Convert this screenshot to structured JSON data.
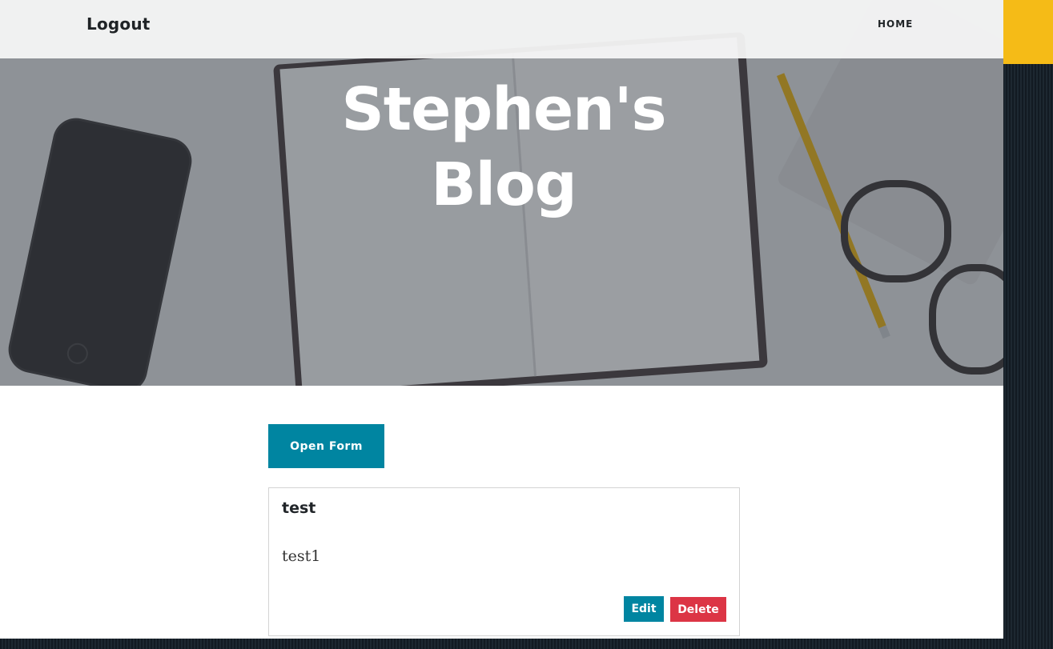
{
  "navbar": {
    "brand_label": "Logout",
    "links": [
      {
        "label": "HOME"
      }
    ]
  },
  "hero": {
    "title_line1": "Stephen's",
    "title_line2": "Blog"
  },
  "main": {
    "open_form_label": "Open Form",
    "posts": [
      {
        "title": "test",
        "body": "test1",
        "edit_label": "Edit",
        "delete_label": "Delete"
      }
    ]
  },
  "colors": {
    "primary": "#0085a1",
    "danger": "#dc3545",
    "accent": "#f5bb17",
    "navbar_bg": "#f6f6f6"
  }
}
